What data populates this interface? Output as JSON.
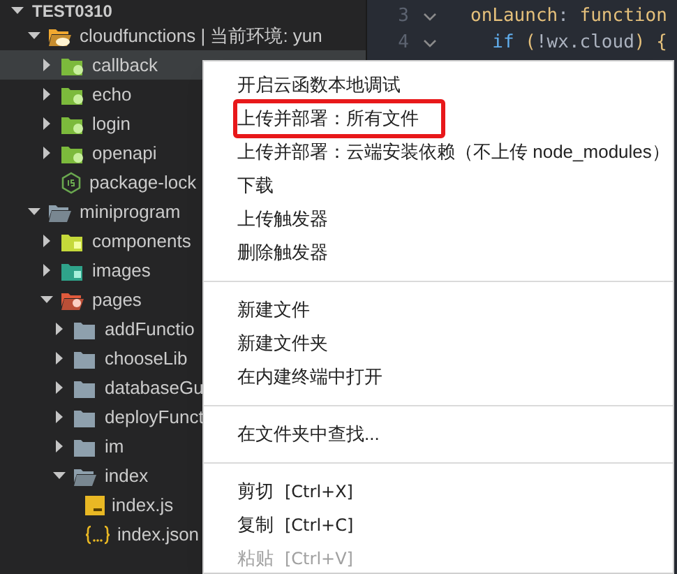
{
  "explorer": {
    "title": "TEST0310",
    "expanded": true,
    "items": [
      {
        "label": "cloudfunctions | 当前环境: yun",
        "kind": "cloud-folder",
        "expanded": true,
        "selected": false,
        "children": [
          {
            "label": "callback",
            "kind": "green-folder",
            "expanded": false,
            "selected": true
          },
          {
            "label": "echo",
            "kind": "green-folder",
            "expanded": false,
            "selected": false
          },
          {
            "label": "login",
            "kind": "green-folder",
            "expanded": false,
            "selected": false
          },
          {
            "label": "openapi",
            "kind": "green-folder",
            "expanded": false,
            "selected": false
          },
          {
            "label": "package-lock",
            "kind": "node-file",
            "selected": false
          }
        ]
      },
      {
        "label": "miniprogram",
        "kind": "folder",
        "expanded": true,
        "selected": false,
        "children": [
          {
            "label": "components",
            "kind": "lime-folder",
            "expanded": false,
            "selected": false
          },
          {
            "label": "images",
            "kind": "teal-folder",
            "expanded": false,
            "selected": false
          },
          {
            "label": "pages",
            "kind": "red-folder",
            "expanded": true,
            "selected": false,
            "children": [
              {
                "label": "addFunctio",
                "kind": "folder",
                "expanded": false,
                "selected": false
              },
              {
                "label": "chooseLib",
                "kind": "folder",
                "expanded": false,
                "selected": false
              },
              {
                "label": "databaseGu",
                "kind": "folder",
                "expanded": false,
                "selected": false
              },
              {
                "label": "deployFunct",
                "kind": "folder",
                "expanded": false,
                "selected": false
              },
              {
                "label": "im",
                "kind": "folder",
                "expanded": false,
                "selected": false
              },
              {
                "label": "index",
                "kind": "folder",
                "expanded": true,
                "selected": false,
                "children": [
                  {
                    "label": "index.js",
                    "kind": "js-file",
                    "selected": false
                  },
                  {
                    "label": "index.json",
                    "kind": "json-file",
                    "selected": false
                  }
                ]
              }
            ]
          }
        ]
      }
    ]
  },
  "editor": {
    "lines": [
      {
        "number": "3",
        "tokens": [
          {
            "text": "onLaunch",
            "color": "#e5c07b"
          },
          {
            "text": ": ",
            "color": "#abb2bf"
          },
          {
            "text": "function",
            "color": "#e5c07b"
          }
        ]
      },
      {
        "number": "4",
        "tokens": [
          {
            "text": "  if ",
            "color": "#61afef"
          },
          {
            "text": "(",
            "color": "#e5c07b"
          },
          {
            "text": "!wx.cloud",
            "color": "#abb2bf"
          },
          {
            "text": ") {",
            "color": "#e5c07b"
          }
        ]
      }
    ]
  },
  "context_menu": {
    "items": [
      {
        "kind": "item",
        "label": "开启云函数本地调试",
        "disabled": false,
        "outlined": false
      },
      {
        "kind": "item",
        "label": "上传并部署：所有文件",
        "disabled": false,
        "outlined": true
      },
      {
        "kind": "item",
        "label": "上传并部署：云端安装依赖（不上传 node_modules）",
        "disabled": false,
        "outlined": false
      },
      {
        "kind": "item",
        "label": "下载",
        "disabled": false,
        "outlined": false
      },
      {
        "kind": "item",
        "label": "上传触发器",
        "disabled": false,
        "outlined": false
      },
      {
        "kind": "item",
        "label": "删除触发器",
        "disabled": false,
        "outlined": false
      },
      {
        "kind": "separator"
      },
      {
        "kind": "item",
        "label": "新建文件",
        "disabled": false,
        "outlined": false
      },
      {
        "kind": "item",
        "label": "新建文件夹",
        "disabled": false,
        "outlined": false
      },
      {
        "kind": "item",
        "label": "在内建终端中打开",
        "disabled": false,
        "outlined": false
      },
      {
        "kind": "separator"
      },
      {
        "kind": "item",
        "label": "在文件夹中查找...",
        "disabled": false,
        "outlined": false
      },
      {
        "kind": "separator"
      },
      {
        "kind": "item",
        "label": "剪切",
        "shortcut": "[Ctrl+X]",
        "disabled": false,
        "outlined": false
      },
      {
        "kind": "item",
        "label": "复制",
        "shortcut": "[Ctrl+C]",
        "disabled": false,
        "outlined": false
      },
      {
        "kind": "item",
        "label": "粘贴",
        "shortcut": "[Ctrl+V]",
        "disabled": true,
        "outlined": false
      },
      {
        "kind": "separator"
      }
    ]
  }
}
